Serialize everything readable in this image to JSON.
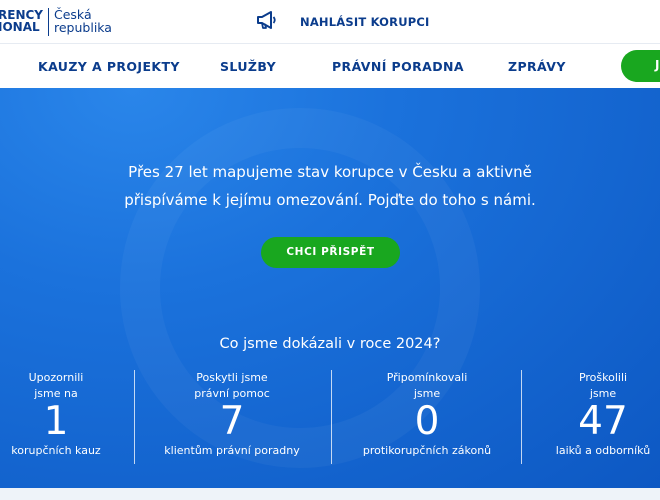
{
  "logo": {
    "left_line1": "RENCY",
    "left_line2": "IONAL",
    "right_line1": "Česká",
    "right_line2": "republika"
  },
  "topbar": {
    "report_label": "NAHLÁSIT KORUPCI",
    "report_icon": "megaphone-icon"
  },
  "nav": {
    "items": [
      "KAUZY A PROJEKTY",
      "SLUŽBY",
      "PRÁVNÍ PORADNA",
      "ZPRÁVY"
    ],
    "cta_label": "J"
  },
  "hero": {
    "line1": "Přes 27 let mapujeme stav korupce v Česku a aktivně",
    "line2": "přispíváme k jejímu omezování. Pojďte do toho s námi.",
    "cta_label": "CHCI PŘISPĚT",
    "stats_title": "Co jsme dokázali v roce 2024?"
  },
  "stats": [
    {
      "top1": "Upozornili",
      "top2": "jsme na",
      "value": "1",
      "bottom": "korupčních kauz"
    },
    {
      "top1": "Poskytli jsme",
      "top2": "právní pomoc",
      "value": "7",
      "bottom": "klientům právní poradny"
    },
    {
      "top1": "Připomínkovali",
      "top2": "jsme",
      "value": "0",
      "bottom": "protikorupčních zákonů"
    },
    {
      "top1": "Proškolili",
      "top2": "jsme",
      "value": "47",
      "bottom": "laiků a odborníků"
    }
  ],
  "colors": {
    "brand_blue": "#0b3c8c",
    "hero_blue": "#1b72dc",
    "green": "#19a71f"
  }
}
